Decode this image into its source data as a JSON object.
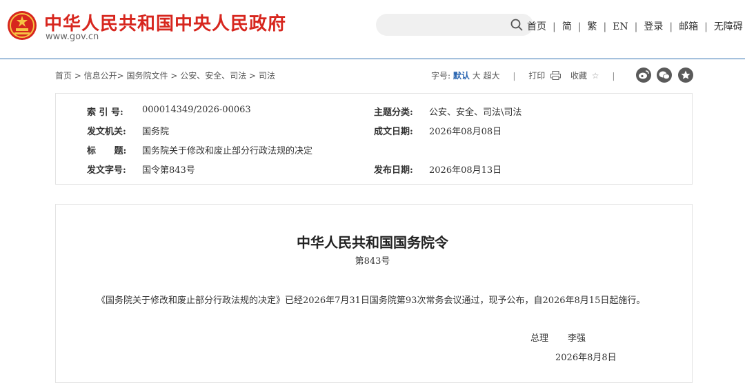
{
  "header": {
    "site_title": "中华人民共和国中央人民政府",
    "site_url": "www.gov.cn",
    "search_placeholder": "",
    "nav": [
      "首页",
      "简",
      "繁",
      "EN",
      "登录",
      "邮箱",
      "无障碍"
    ],
    "brand_color": "#d7261e"
  },
  "breadcrumb": {
    "text": "首页 > 信息公开> 国务院文件 > 公安、安全、司法 > 司法"
  },
  "tools": {
    "font_label": "字号:",
    "font_default": "默认",
    "font_large": "大",
    "font_xlarge": "超大",
    "print_label": "打印",
    "favorite_label": "收藏",
    "accent_color": "#2b66b1",
    "icons": [
      "printer-icon",
      "star-icon",
      "weibo-icon",
      "wechat-icon",
      "favorite-icon"
    ]
  },
  "info": {
    "index_label": "索 引 号:",
    "index_value": "000014349/2026-00063",
    "topic_label": "主题分类:",
    "topic_value": "公安、安全、司法\\司法",
    "issuer_label": "发文机关:",
    "issuer_value": "国务院",
    "written_date_label": "成文日期:",
    "written_date_value": "2026年08月08日",
    "title_label": "标 题:",
    "title_value": "国务院关于修改和废止部分行政法规的决定",
    "doc_no_label": "发文字号:",
    "doc_no_value": "国令第843号",
    "publish_date_label": "发布日期:",
    "publish_date_value": "2026年08月13日"
  },
  "document": {
    "title": "中华人民共和国国务院令",
    "number": "第843号",
    "body": "《国务院关于修改和废止部分行政法规的决定》已经2026年7月31日国务院第93次常务会议通过，现予公布，自2026年8月15日起施行。",
    "signer_title": "总理",
    "signer_name": "李强",
    "sign_date": "2026年8月8日"
  }
}
